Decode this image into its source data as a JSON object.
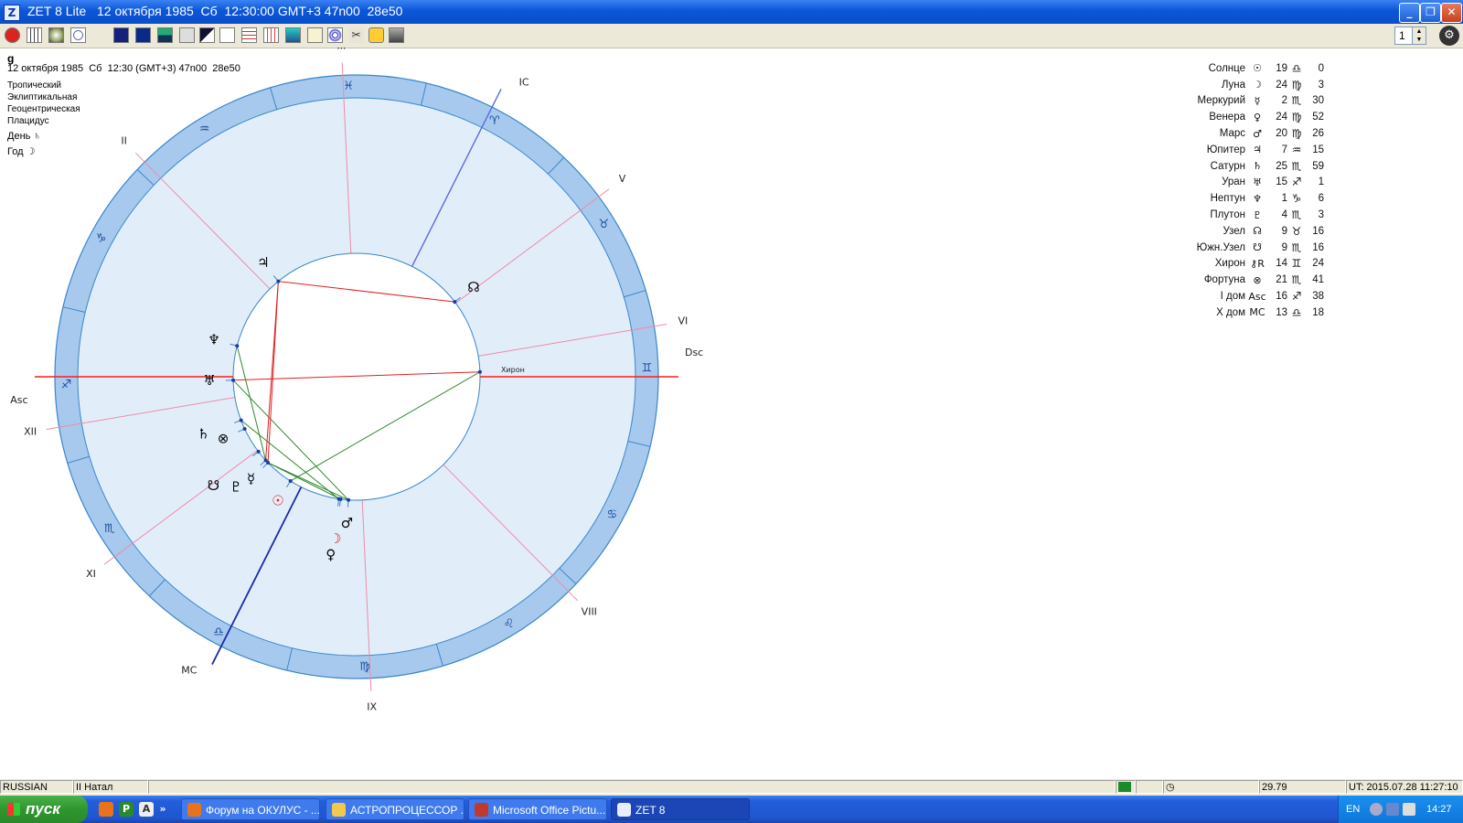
{
  "window": {
    "title": "ZET 8 Lite   12 октября 1985  Сб  12:30:00 GMT+3 47n00  28e50",
    "icon": "zet-logo-icon",
    "controls": [
      "minimize",
      "maximize",
      "close"
    ]
  },
  "toolbar": {
    "icons": [
      "red-star-icon",
      "calendar-grid-icon",
      "globe-map-icon",
      "circle-chart-icon",
      "navy-square-icon",
      "star-map-icon",
      "chart-box-icon",
      "copy-icon",
      "tool-bracket-icon",
      "notepad-icon",
      "bar-table-icon",
      "red-grid-icon",
      "teal-image-icon",
      "document-icon",
      "target-icon",
      "scissors-tools-icon",
      "person-alert-icon",
      "print-icon"
    ],
    "spinner_value": "1",
    "gear": "settings-icon"
  },
  "info": {
    "name": "g",
    "line1": "12 октября 1985  Сб  12:30 (GMT+3) 47n00  28e50",
    "zodiac": "Тропический",
    "coords": "Эклиптикальная",
    "center": "Геоцентрическая",
    "houses": "Плацидус",
    "day_label": "День",
    "day_ruler": "♄",
    "year_label": "Год",
    "year_ruler": "☽"
  },
  "planets": [
    {
      "name": "Солнце",
      "glyph": "☉",
      "deg": "19",
      "sign": "♎",
      "min": "0"
    },
    {
      "name": "Луна",
      "glyph": "☽",
      "deg": "24",
      "sign": "♍",
      "min": "3"
    },
    {
      "name": "Меркурий",
      "glyph": "☿",
      "deg": "2",
      "sign": "♏",
      "min": "30"
    },
    {
      "name": "Венера",
      "glyph": "♀",
      "deg": "24",
      "sign": "♍",
      "min": "52"
    },
    {
      "name": "Марс",
      "glyph": "♂",
      "deg": "20",
      "sign": "♍",
      "min": "26"
    },
    {
      "name": "Юпитер",
      "glyph": "♃",
      "deg": "7",
      "sign": "♒",
      "min": "15"
    },
    {
      "name": "Сатурн",
      "glyph": "♄",
      "deg": "25",
      "sign": "♏",
      "min": "59"
    },
    {
      "name": "Уран",
      "glyph": "♅",
      "deg": "15",
      "sign": "♐",
      "min": "1"
    },
    {
      "name": "Нептун",
      "glyph": "♆",
      "deg": "1",
      "sign": "♑",
      "min": "6"
    },
    {
      "name": "Плутон",
      "glyph": "♇",
      "deg": "4",
      "sign": "♏",
      "min": "3"
    },
    {
      "name": "Узел",
      "glyph": "☊",
      "deg": "9",
      "sign": "♉",
      "min": "16"
    },
    {
      "name": "Южн.Узел",
      "glyph": "☋",
      "deg": "9",
      "sign": "♏",
      "min": "16"
    },
    {
      "name": "Хирон",
      "glyph": "⚷R",
      "deg": "14",
      "sign": "♊",
      "min": "24"
    },
    {
      "name": "Фортуна",
      "glyph": "⊗",
      "deg": "21",
      "sign": "♏",
      "min": "41"
    },
    {
      "name": "I дом",
      "glyph": "Asc",
      "deg": "16",
      "sign": "♐",
      "min": "38"
    },
    {
      "name": "X дом",
      "glyph": "MC",
      "deg": "13",
      "sign": "♎",
      "min": "18"
    }
  ],
  "chart": {
    "asc_deg": 256.63,
    "ang_labels": {
      "asc": "Asc",
      "dsc": "Dsc",
      "mc": "MC",
      "ic": "IC"
    },
    "house_labels": [
      "I",
      "II",
      "III",
      "IV",
      "V",
      "VI",
      "VII",
      "VIII",
      "IX",
      "X",
      "XI",
      "XII"
    ],
    "cusps": [
      256.63,
      302,
      344,
      13.3,
      40,
      67,
      76.63,
      122,
      164,
      193.3,
      220,
      247
    ],
    "sign_glyphs": [
      "♈",
      "♉",
      "♊",
      "♋",
      "♌",
      "♍",
      "♎",
      "♏",
      "♐",
      "♑",
      "♒",
      "♓"
    ],
    "bodies": [
      {
        "glyph": "☉",
        "lon": 199.0,
        "color": "#e02020"
      },
      {
        "glyph": "☽",
        "lon": 174.05,
        "color": "#e02020"
      },
      {
        "glyph": "☿",
        "lon": 212.5,
        "color": "#000000"
      },
      {
        "glyph": "♀",
        "lon": 174.87,
        "color": "#000000"
      },
      {
        "glyph": "♂",
        "lon": 170.43,
        "color": "#000000"
      },
      {
        "glyph": "♃",
        "lon": 307.25,
        "color": "#000000"
      },
      {
        "glyph": "♄",
        "lon": 235.98,
        "color": "#000000"
      },
      {
        "glyph": "♅",
        "lon": 255.02,
        "color": "#000000"
      },
      {
        "glyph": "♆",
        "lon": 271.1,
        "color": "#000000"
      },
      {
        "glyph": "♇",
        "lon": 214.05,
        "color": "#000000"
      },
      {
        "glyph": "☊",
        "lon": 39.27,
        "color": "#000000"
      },
      {
        "glyph": "☋",
        "lon": 219.27,
        "color": "#000000"
      },
      {
        "glyph": "⊗",
        "lon": 231.68,
        "color": "#000000"
      }
    ],
    "chiron_label": "Хирон",
    "chiron_lon": 74.4,
    "aspects": [
      {
        "a": 212.5,
        "b": 174.05,
        "color": "#2a8a2a"
      },
      {
        "a": 212.5,
        "b": 170.43,
        "color": "#2a8a2a"
      },
      {
        "a": 235.98,
        "b": 174.87,
        "color": "#2a8a2a"
      },
      {
        "a": 255.02,
        "b": 170.43,
        "color": "#2a8a2a"
      },
      {
        "a": 199.0,
        "b": 74.4,
        "color": "#2a8a2a"
      },
      {
        "a": 271.1,
        "b": 214.05,
        "color": "#2a8a2a"
      },
      {
        "a": 307.25,
        "b": 212.5,
        "color": "#e02020"
      },
      {
        "a": 307.25,
        "b": 214.05,
        "color": "#e02020"
      },
      {
        "a": 307.25,
        "b": 39.27,
        "color": "#e02020"
      },
      {
        "a": 255.02,
        "b": 74.4,
        "color": "#e02020"
      }
    ]
  },
  "statusbar": {
    "lang": "RUSSIAN",
    "mode": "II Натал",
    "value": "29.79",
    "ut": "UT: 2015.07.28 11:27:10"
  },
  "taskbar": {
    "start": "пуск",
    "tasks": [
      {
        "label": "Форум на ОКУЛУС - ...",
        "icon": "firefox-icon",
        "color": "#e8731a"
      },
      {
        "label": "АСТРОПРОЦЕССОР ...",
        "icon": "folder-icon",
        "color": "#f2c94c"
      },
      {
        "label": "Microsoft Office Pictu...",
        "icon": "office-picture-icon",
        "color": "#c0392b"
      },
      {
        "label": "ZET 8",
        "icon": "zet-logo-icon",
        "color": "#e9eefc"
      }
    ],
    "lang": "EN",
    "clock": "14:27"
  }
}
